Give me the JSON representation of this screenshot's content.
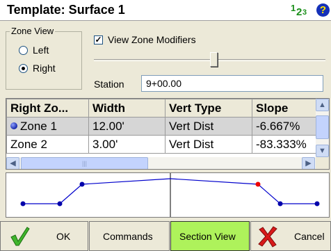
{
  "titlebar": {
    "title": "Template: Surface 1",
    "units_icon": "units-123-icon",
    "units_text": [
      "1",
      "2",
      "3"
    ],
    "help_icon": "help-question-icon",
    "help_symbol": "?"
  },
  "zone_view": {
    "legend": "Zone View",
    "options": [
      {
        "label": "Left",
        "selected": false
      },
      {
        "label": "Right",
        "selected": true
      }
    ]
  },
  "modifiers": {
    "label": "View Zone Modifiers",
    "checked": true
  },
  "slider": {
    "icon": "slider-thumb"
  },
  "station": {
    "label": "Station",
    "value": "9+00.00"
  },
  "table": {
    "columns": [
      "Right Zo...",
      "Width",
      "Vert Type",
      "Slope"
    ],
    "rows": [
      {
        "zone": "Zone 1",
        "width": "12.00'",
        "vert_type": "Vert Dist",
        "slope": "-6.667%",
        "selected": true,
        "icon": "point-marker-icon"
      },
      {
        "zone": "Zone 2",
        "width": "3.00'",
        "vert_type": "Vert Dist",
        "slope": "-83.333%",
        "selected": false
      }
    ],
    "scroll_up_glyph": "▲",
    "scroll_down_glyph": "▼",
    "scroll_left_glyph": "◀",
    "scroll_right_glyph": "▶",
    "scroll_grip": "|||"
  },
  "graph": {
    "line_color": "#0000cc",
    "point_color": "#0000aa",
    "highlight_point_color": "#ee0000",
    "centerline_color": "#000000"
  },
  "buttons": {
    "ok": "OK",
    "commands": "Commands",
    "section_view": "Section View",
    "cancel": "Cancel",
    "section_view_color": "#aef25b"
  }
}
